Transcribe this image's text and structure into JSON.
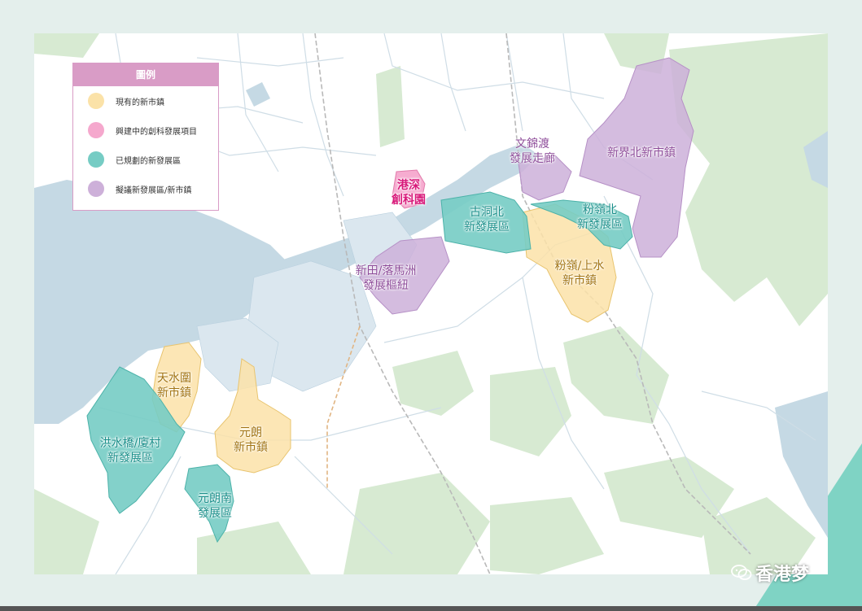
{
  "legend": {
    "title": "圖例",
    "items": [
      {
        "label": "現有的新市鎮",
        "color": "#fbe2a8"
      },
      {
        "label": "興建中的創科發展項目",
        "color": "#f5a8cd"
      },
      {
        "label": "已規劃的新發展區",
        "color": "#76ccc4"
      },
      {
        "label": "擬議新發展區/新市鎮",
        "color": "#cdb0d9"
      }
    ]
  },
  "areas": {
    "tin_shui_wai": {
      "line1": "天水圍",
      "line2": "新市鎮",
      "color": "#a27413"
    },
    "yuen_long": {
      "line1": "元朗",
      "line2": "新市鎮",
      "color": "#a27413"
    },
    "hung_shui_kiu": {
      "line1": "洪水橋/廈村",
      "line2": "新發展區",
      "color": "#1a8f8a"
    },
    "yuen_long_south": {
      "line1": "元朗南",
      "line2": "發展區",
      "color": "#1a8f8a"
    },
    "san_tin": {
      "line1": "新田/落馬洲",
      "line2": "發展樞紐",
      "color": "#8e4d9a"
    },
    "hsitp": {
      "line1": "港深",
      "line2": "創科園",
      "color": "#d8197a"
    },
    "kwu_tung_north": {
      "line1": "古洞北",
      "line2": "新發展區",
      "color": "#1a8f8a"
    },
    "man_kam_to": {
      "line1": "文錦渡",
      "line2": "發展走廊",
      "color": "#8e4d9a"
    },
    "fanling_north": {
      "line1": "粉嶺北",
      "line2": "新發展區",
      "color": "#1a8f8a"
    },
    "fanling_sheung_shui": {
      "line1": "粉嶺/上水",
      "line2": "新市鎮",
      "color": "#a27413"
    },
    "new_territories_north": {
      "line1": "新界北新市鎮",
      "line2": "",
      "color": "#8e4d9a"
    }
  },
  "colors": {
    "background": "#e4efec",
    "water": "#c5d9e4",
    "green_belt": "#d7ead2",
    "road": "#cfdde6"
  },
  "watermark": {
    "text": "香港梦",
    "icon": "wechat-icon"
  }
}
